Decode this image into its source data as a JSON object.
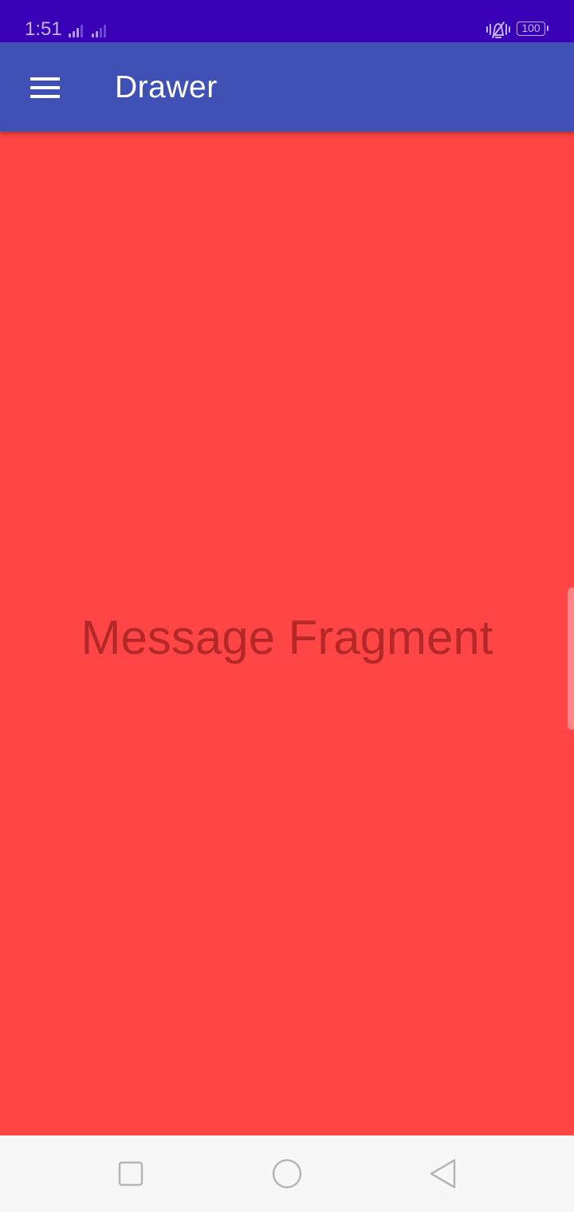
{
  "status_bar": {
    "time": "1:51",
    "battery_level": "100",
    "icons": [
      "signal-icon",
      "signal-icon",
      "vibrate-icon",
      "battery-icon"
    ]
  },
  "app_bar": {
    "title": "Drawer",
    "menu_icon": "hamburger-menu-icon"
  },
  "content": {
    "text": "Message Fragment"
  },
  "nav_bar": {
    "buttons": [
      "recents-icon",
      "home-icon",
      "back-icon"
    ]
  },
  "colors": {
    "status_bar": "#3a00b5",
    "app_bar": "#3f51b5",
    "content_background": "#ff4545",
    "content_text": "#b42828",
    "nav_bar": "#f7f7f7"
  }
}
